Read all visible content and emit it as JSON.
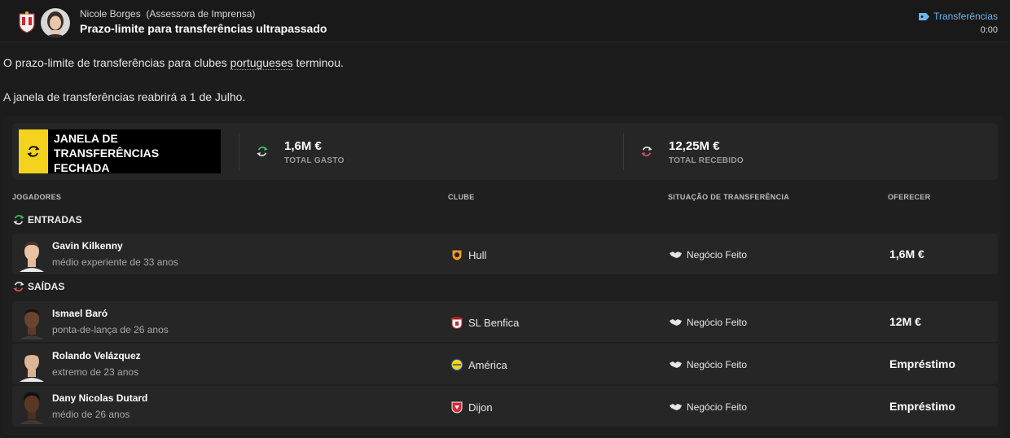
{
  "header": {
    "sender_name": "Nicole Borges",
    "sender_role": "(Assessora de Imprensa)",
    "subject": "Prazo-limite para transferências ultrapassado",
    "tag": "Transferências",
    "time": "0:00"
  },
  "message": {
    "line1_before": "O prazo-limite de transferências para clubes ",
    "line1_link": "portugueses",
    "line1_after": " terminou.",
    "line2": "A janela de transferências reabrirá a 1 de Julho."
  },
  "summary": {
    "window_status": "JANELA DE TRANSFERÊNCIAS FECHADA",
    "spent_value": "1,6M €",
    "spent_label": "TOTAL GASTO",
    "received_value": "12,25M €",
    "received_label": "TOTAL RECEBIDO"
  },
  "columns": {
    "players": "JOGADORES",
    "club": "CLUBE",
    "status": "SITUAÇÃO DE TRANSFERÊNCIA",
    "offer": "OFERECER"
  },
  "sections": {
    "in": "ENTRADAS",
    "out": "SAÍDAS"
  },
  "incoming": [
    {
      "name": "Gavin Kilkenny",
      "desc": "médio experiente de 33 anos",
      "club": "Hull",
      "status": "Negócio Feito",
      "offer": "1,6M €"
    }
  ],
  "outgoing": [
    {
      "name": "Ismael Baró",
      "desc": "ponta-de-lança de 26 anos",
      "club": "SL Benfica",
      "status": "Negócio Feito",
      "offer": "12M €"
    },
    {
      "name": "Rolando Velázquez",
      "desc": "extremo de 23 anos",
      "club": "América",
      "status": "Negócio Feito",
      "offer": "Empréstimo"
    },
    {
      "name": "Dany Nicolas Dutard",
      "desc": "médio de 26 anos",
      "club": "Dijon",
      "status": "Negócio Feito",
      "offer": "Empréstimo"
    }
  ],
  "colors": {
    "accent_yellow": "#f4d21d",
    "in_green": "#3cc46a",
    "out_red": "#e0555d",
    "link_blue": "#6cb6ee"
  }
}
